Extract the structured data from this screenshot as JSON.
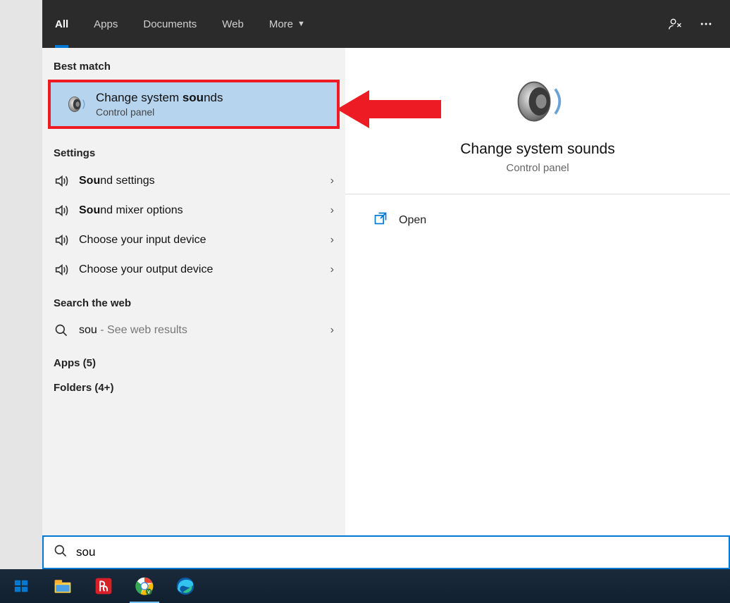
{
  "tabs": {
    "all": "All",
    "apps": "Apps",
    "documents": "Documents",
    "web": "Web",
    "more": "More"
  },
  "sections": {
    "best_match": "Best match",
    "settings": "Settings",
    "search_web": "Search the web",
    "apps_count": "Apps (5)",
    "folders_count": "Folders (4+)"
  },
  "best_match_item": {
    "title_pre": "Change system ",
    "title_bold": "sou",
    "title_post": "nds",
    "subtitle": "Control panel"
  },
  "settings_items": [
    {
      "bold": "Sou",
      "rest": "nd settings"
    },
    {
      "bold": "Sou",
      "rest": "nd mixer options"
    },
    {
      "bold": "",
      "rest": "Choose your input device"
    },
    {
      "bold": "",
      "rest": "Choose your output device"
    }
  ],
  "web_result": {
    "query": "sou",
    "suffix": " - See web results"
  },
  "preview": {
    "title": "Change system sounds",
    "subtitle": "Control panel",
    "open": "Open"
  },
  "search_input": {
    "value": "sou"
  }
}
